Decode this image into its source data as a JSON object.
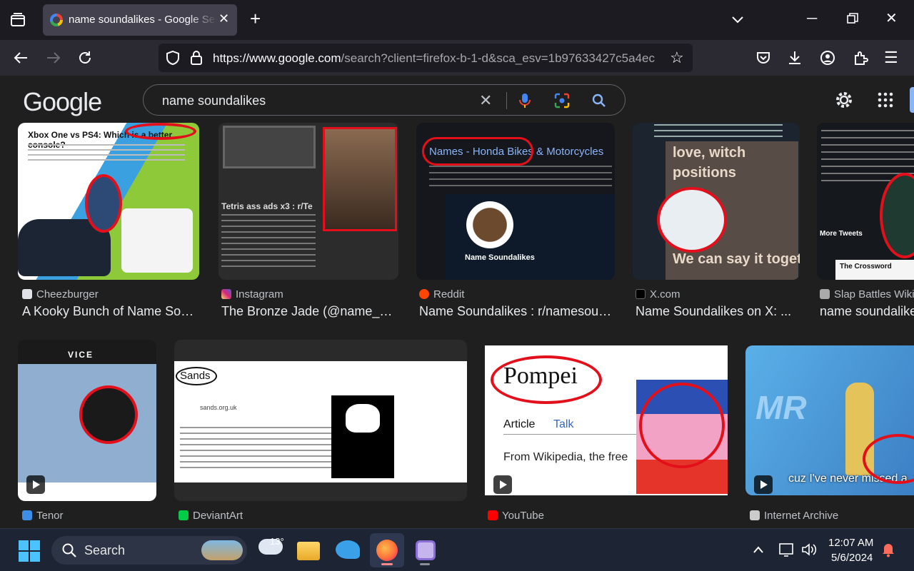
{
  "browser": {
    "tab_title": "name soundalikes - Google Search",
    "url_domain": "https://www.google.com",
    "url_rest": "/search?client=firefox-b-1-d&sca_esv=1b97633427c5a4ec"
  },
  "google": {
    "logo": "Google",
    "query": "name soundalikes"
  },
  "results": [
    {
      "source": "Cheezburger",
      "caption": "A Kooky Bunch of Name Sound...",
      "thumb_text": "Xbox One vs PS4: Which is a better console?",
      "source_color": "#e8e8e8"
    },
    {
      "source": "Instagram",
      "caption": "The Bronze Jade (@name_soundalikes...",
      "thumb_text": "Tetris ass ads x3 : r/Te",
      "source_color": "#d62976"
    },
    {
      "source": "Reddit",
      "caption": "Name Soundalikes : r/namesoundalikes",
      "thumb_text": "Names - Honda Bikes & Motorcycles",
      "thumb_sub": "Name Soundalikes",
      "source_color": "#ff4500"
    },
    {
      "source": "X.com",
      "caption": "Name Soundalikes on X: ...",
      "thumb_text": "love, witch positions",
      "thumb_sub": "We can say it together",
      "source_color": "#000000"
    },
    {
      "source": "Slap Battles Wiki",
      "caption": "name soundalikes",
      "thumb_text": "More Tweets",
      "thumb_sub": "The Crossword",
      "source_color": "#cccccc"
    },
    {
      "source": "Tenor",
      "caption": "",
      "thumb_text": "VICE",
      "source_color": "#3c8ee7"
    },
    {
      "source": "DeviantArt",
      "caption": "",
      "thumb_text": "Sands",
      "thumb_sub": "sands.org.uk",
      "source_color": "#05cc47"
    },
    {
      "source": "YouTube",
      "caption": "",
      "thumb_text": "Pompei",
      "thumb_sub": "From Wikipedia, the free",
      "tab_article": "Article",
      "tab_talk": "Talk",
      "source_color": "#ff0000"
    },
    {
      "source": "Internet Archive",
      "caption": "",
      "thumb_text": "cuz I've never missed a",
      "source_color": "#cccccc"
    }
  ],
  "taskbar": {
    "search_label": "Search",
    "temperature": "13°",
    "time": "12:07 AM",
    "date": "5/6/2024"
  }
}
